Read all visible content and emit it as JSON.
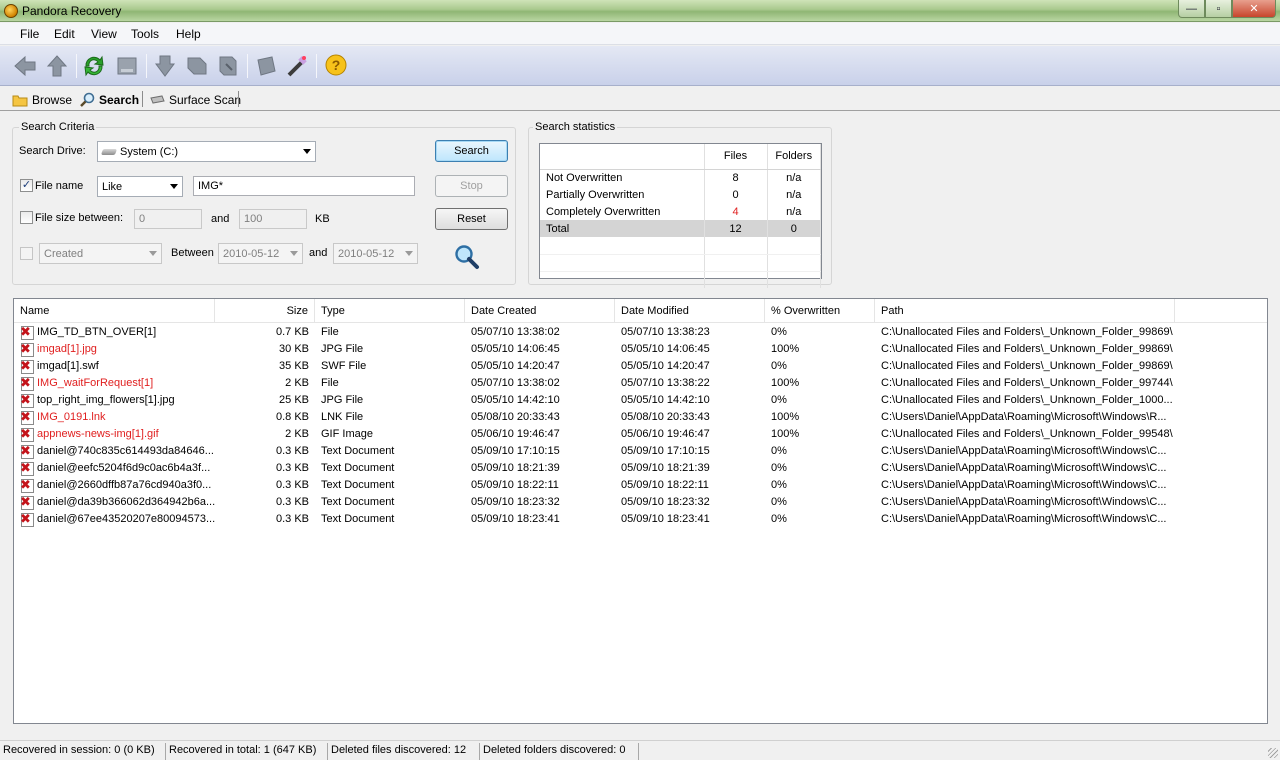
{
  "window": {
    "title": "Pandora Recovery",
    "minimize": "—",
    "maximize": "▫",
    "close": "✕"
  },
  "menu": [
    "File",
    "Edit",
    "View",
    "Tools",
    "Help"
  ],
  "toolbar": {
    "icons": [
      "back-icon",
      "up-icon",
      "refresh-icon",
      "drive-icon",
      "recover-icon",
      "recover-all-icon",
      "recover-tree-icon",
      "disk-icon",
      "wand-icon",
      "help-icon"
    ]
  },
  "tabs": [
    {
      "label": "Browse",
      "icon": "folder-icon",
      "active": false
    },
    {
      "label": "Search",
      "icon": "magnifier-icon",
      "active": true
    },
    {
      "label": "Surface Scan",
      "icon": "drive-icon",
      "active": false
    }
  ],
  "criteria": {
    "group_label": "Search Criteria",
    "drive_label": "Search Drive:",
    "drive_value": "System (C:)",
    "file_name_label": "File name",
    "file_name_checked": true,
    "match_mode": "Like",
    "file_name_value": "IMG*",
    "size_label": "File size between:",
    "size_checked": false,
    "size_min": "0",
    "size_and": "and",
    "size_max": "100",
    "size_unit": "KB",
    "date_checked": false,
    "date_type": "Created",
    "between_label": "Between",
    "date_from": "2010-05-12",
    "date_and": "and",
    "date_to": "2010-05-12",
    "search_button": "Search",
    "stop_button": "Stop",
    "reset_button": "Reset"
  },
  "stats": {
    "group_label": "Search statistics",
    "columns": [
      "",
      "Files",
      "Folders"
    ],
    "rows": [
      {
        "label": "Not Overwritten",
        "files": "8",
        "folders": "n/a",
        "files_red": false
      },
      {
        "label": "Partially Overwritten",
        "files": "0",
        "folders": "n/a",
        "files_red": false
      },
      {
        "label": "Completely Overwritten",
        "files": "4",
        "folders": "n/a",
        "files_red": true
      },
      {
        "label": "Total",
        "files": "12",
        "folders": "0",
        "files_red": false,
        "total": true
      }
    ]
  },
  "results": {
    "columns": [
      "Name",
      "Size",
      "Type",
      "Date Created",
      "Date Modified",
      "% Overwritten",
      "Path"
    ],
    "rows": [
      {
        "name": "IMG_TD_BTN_OVER[1]",
        "size": "0.7 KB",
        "type": " File",
        "created": "05/07/10 13:38:02",
        "modified": "05/07/10 13:38:23",
        "overwritten": "0%",
        "path": "C:\\Unallocated Files and Folders\\_Unknown_Folder_99869\\",
        "red": false
      },
      {
        "name": "imgad[1].jpg",
        "size": "30 KB",
        "type": "JPG File",
        "created": "05/05/10 14:06:45",
        "modified": "05/05/10 14:06:45",
        "overwritten": " 100%",
        "path": "C:\\Unallocated Files and Folders\\_Unknown_Folder_99869\\",
        "red": true
      },
      {
        "name": "imgad[1].swf",
        "size": "35 KB",
        "type": "SWF File",
        "created": "05/05/10 14:20:47",
        "modified": "05/05/10 14:20:47",
        "overwritten": "0%",
        "path": "C:\\Unallocated Files and Folders\\_Unknown_Folder_99869\\",
        "red": false
      },
      {
        "name": "IMG_waitForRequest[1]",
        "size": "2 KB",
        "type": " File",
        "created": "05/07/10 13:38:02",
        "modified": "05/07/10 13:38:22",
        "overwritten": " 100%",
        "path": "C:\\Unallocated Files and Folders\\_Unknown_Folder_99744\\",
        "red": true
      },
      {
        "name": "top_right_img_flowers[1].jpg",
        "size": "25 KB",
        "type": "JPG File",
        "created": "05/05/10 14:42:10",
        "modified": "05/05/10 14:42:10",
        "overwritten": "0%",
        "path": "C:\\Unallocated Files and Folders\\_Unknown_Folder_1000...",
        "red": false
      },
      {
        "name": "IMG_0191.lnk",
        "size": "0.8 KB",
        "type": "LNK File",
        "created": "05/08/10 20:33:43",
        "modified": "05/08/10 20:33:43",
        "overwritten": " 100%",
        "path": "C:\\Users\\Daniel\\AppData\\Roaming\\Microsoft\\Windows\\R...",
        "red": true
      },
      {
        "name": "appnews-news-img[1].gif",
        "size": "2 KB",
        "type": "GIF Image",
        "created": "05/06/10 19:46:47",
        "modified": "05/06/10 19:46:47",
        "overwritten": " 100%",
        "path": "C:\\Unallocated Files and Folders\\_Unknown_Folder_99548\\",
        "red": true
      },
      {
        "name": "daniel@740c835c614493da84646...",
        "size": "0.3 KB",
        "type": "Text Document",
        "created": "05/09/10 17:10:15",
        "modified": "05/09/10 17:10:15",
        "overwritten": "0%",
        "path": "C:\\Users\\Daniel\\AppData\\Roaming\\Microsoft\\Windows\\C...",
        "red": false
      },
      {
        "name": "daniel@eefc5204f6d9c0ac6b4a3f...",
        "size": "0.3 KB",
        "type": "Text Document",
        "created": "05/09/10 18:21:39",
        "modified": "05/09/10 18:21:39",
        "overwritten": "0%",
        "path": "C:\\Users\\Daniel\\AppData\\Roaming\\Microsoft\\Windows\\C...",
        "red": false
      },
      {
        "name": "daniel@2660dffb87a76cd940a3f0...",
        "size": "0.3 KB",
        "type": "Text Document",
        "created": "05/09/10 18:22:11",
        "modified": "05/09/10 18:22:11",
        "overwritten": "0%",
        "path": "C:\\Users\\Daniel\\AppData\\Roaming\\Microsoft\\Windows\\C...",
        "red": false
      },
      {
        "name": "daniel@da39b366062d364942b6a...",
        "size": "0.3 KB",
        "type": "Text Document",
        "created": "05/09/10 18:23:32",
        "modified": "05/09/10 18:23:32",
        "overwritten": "0%",
        "path": "C:\\Users\\Daniel\\AppData\\Roaming\\Microsoft\\Windows\\C...",
        "red": false
      },
      {
        "name": "daniel@67ee43520207e80094573...",
        "size": "0.3 KB",
        "type": "Text Document",
        "created": "05/09/10 18:23:41",
        "modified": "05/09/10 18:23:41",
        "overwritten": "0%",
        "path": "C:\\Users\\Daniel\\AppData\\Roaming\\Microsoft\\Windows\\C...",
        "red": false
      }
    ]
  },
  "status": {
    "session": "Recovered in session: 0 (0 KB)",
    "total": "Recovered in total: 1 (647 KB)",
    "files": "Deleted files discovered: 12",
    "folders": "Deleted folders discovered: 0"
  },
  "colors": {
    "accent_red": "#e02020",
    "toolbar": "#c9d1ea",
    "titlebar": "#a9c98e"
  }
}
